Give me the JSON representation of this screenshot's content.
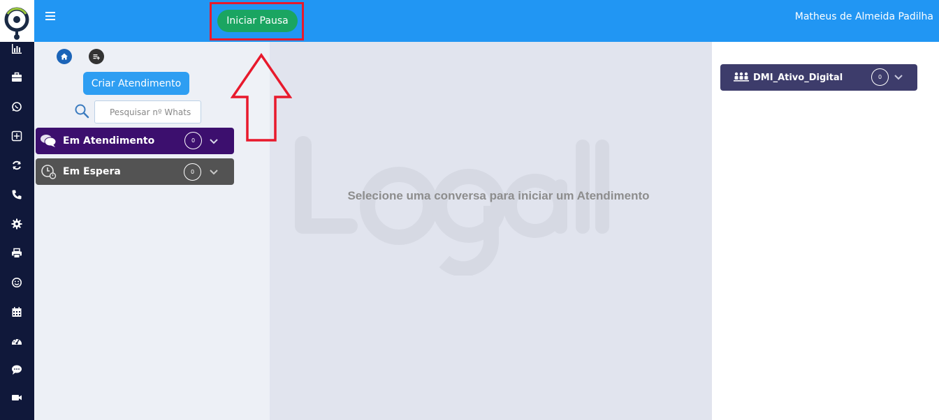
{
  "topbar": {
    "pause_button_label": "Iniciar Pausa",
    "user_name": "Matheus de Almeida Padilha"
  },
  "sidebar": {
    "icons": [
      "bar-chart-icon",
      "briefcase-icon",
      "whatsapp-icon",
      "plus-square-icon",
      "refresh-icon",
      "phone-icon",
      "gear-icon",
      "printer-icon",
      "smile-icon",
      "calendar-icon",
      "dashboard-icon",
      "comment-icon",
      "video-icon"
    ]
  },
  "left_panel": {
    "create_button_label": "Criar Atendimento",
    "search_placeholder": "Pesquisar nº Whats",
    "queues": [
      {
        "label": "Em Atendimento",
        "count": "0",
        "color": "#3c0f6e"
      },
      {
        "label": "Em Espera",
        "count": "0",
        "color": "#535353"
      }
    ]
  },
  "center": {
    "empty_message": "Selecione uma conversa para iniciar um Atendimento"
  },
  "right_panel": {
    "campaign_label": "DMI_Ativo_Digital",
    "campaign_count": "0"
  },
  "colors": {
    "topbar": "#2196f3",
    "rail": "#10183a",
    "pause_button": "#1aa561",
    "highlight": "#e8192c",
    "campaign": "#3d3c6b"
  }
}
